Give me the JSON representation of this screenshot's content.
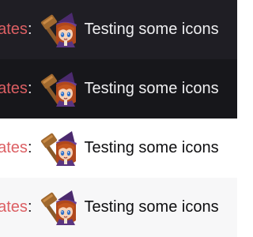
{
  "rows": [
    {
      "theme": "dark",
      "username": "eates",
      "message": "Testing some icons",
      "emote": "hammer-witch-girl-emote"
    },
    {
      "theme": "dark",
      "username": "eates",
      "message": "Testing some icons",
      "emote": "hammer-witch-girl-emote"
    },
    {
      "theme": "light",
      "username": "eates",
      "message": "Testing some icons",
      "emote": "hammer-witch-girl-emote"
    },
    {
      "theme": "light",
      "username": "eates",
      "message": "Testing some icons",
      "emote": "hammer-witch-girl-emote"
    }
  ],
  "colors": {
    "username": "#dc5f63",
    "dark_bg_1": "#1f1e24",
    "dark_bg_2": "#17171b",
    "light_bg_1": "#ffffff",
    "light_bg_2": "#f7f7f8"
  }
}
